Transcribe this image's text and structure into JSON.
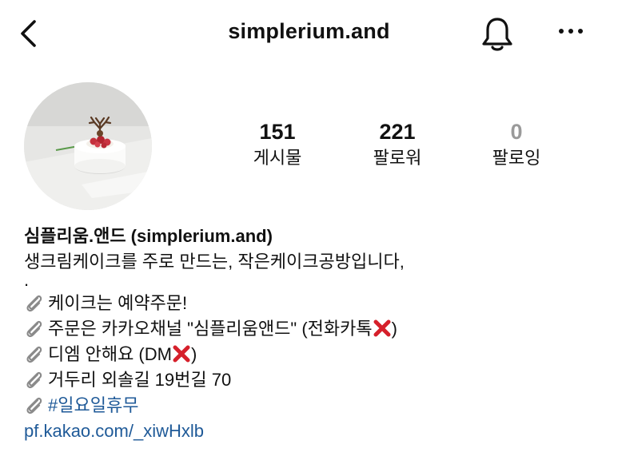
{
  "header": {
    "username": "simplerium.and",
    "back_icon": "chevron-left-icon",
    "bell_icon": "bell-icon",
    "more_icon": "more-horizontal-icon"
  },
  "stats": {
    "posts": {
      "count": "151",
      "label": "게시물"
    },
    "followers": {
      "count": "221",
      "label": "팔로워"
    },
    "following": {
      "count": "0",
      "label": "팔로잉"
    }
  },
  "bio": {
    "name": "심플리움.앤드 (simplerium.and)",
    "description": "생크림케이크를 주로 만드는, 작은케이크공방입니다,",
    "separator": ".",
    "lines": [
      {
        "icon": "paperclip-icon",
        "text": "케이크는 예약주문!"
      },
      {
        "icon": "paperclip-icon",
        "text": "주문은 카카오채널 \"심플리움앤드\" (전화카톡",
        "suffix_icon": "cross-mark-icon",
        "suffix_text": ")"
      },
      {
        "icon": "paperclip-icon",
        "text": "디엠 안해요 (DM",
        "suffix_icon": "cross-mark-icon",
        "suffix_text": ")"
      },
      {
        "icon": "paperclip-icon",
        "text": "거두리 외솔길 19번길 70"
      },
      {
        "icon": "paperclip-icon",
        "text": "#일요일휴무"
      }
    ],
    "link": "pf.kakao.com/_xiwHxlb"
  },
  "colors": {
    "text": "#111111",
    "muted": "#9a9a9a",
    "link": "#1f5a98",
    "cross_red": "#d6202b"
  }
}
